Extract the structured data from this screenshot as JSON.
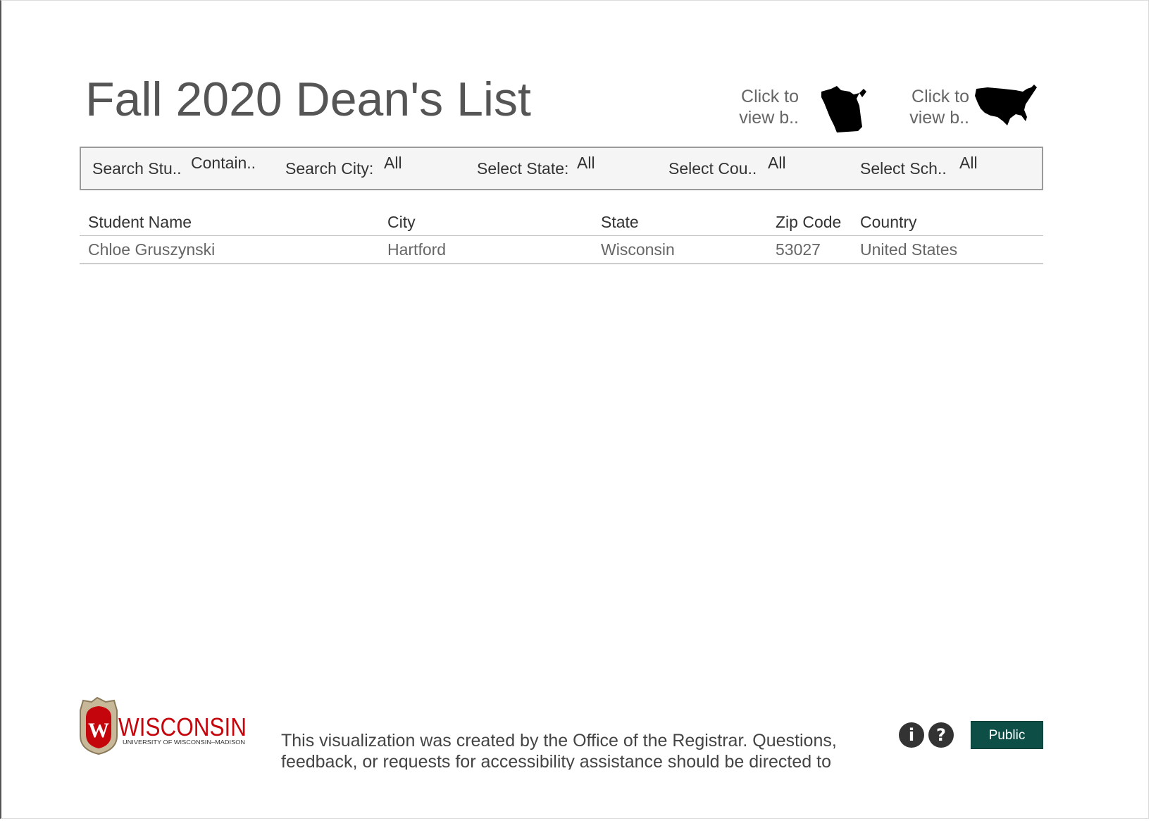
{
  "header": {
    "title": "Fall 2020 Dean's List",
    "nav_wisconsin": {
      "text": "Click to\nview b..",
      "icon": "wisconsin-map-icon"
    },
    "nav_usa": {
      "text": "Click to\nview b..",
      "icon": "usa-map-icon"
    }
  },
  "filters": [
    {
      "label": "Search Stu..",
      "value": "Contain.."
    },
    {
      "label": "Search City:",
      "value": "All"
    },
    {
      "label": "Select State:",
      "value": "All"
    },
    {
      "label": "Select Cou..",
      "value": "All"
    },
    {
      "label": "Select Sch..",
      "value": "All"
    }
  ],
  "table": {
    "columns": [
      "Student Name",
      "City",
      "State",
      "Zip Code",
      "Country"
    ],
    "rows": [
      [
        "Chloe Gruszynski",
        "Hartford",
        "Wisconsin",
        "53027",
        "United States"
      ]
    ]
  },
  "footer": {
    "logo_text": "WISCONSIN",
    "logo_subtext": "UNIVERSITY OF WISCONSIN–MADISON",
    "note": "This visualization was created by the Office of the Registrar.  Questions, feedback, or requests for accessibility assistance should be directed to",
    "info_icon": "info-icon",
    "help_icon": "help-icon",
    "public_label": "Public"
  },
  "colors": {
    "accent_public": "#0d4f47",
    "uw_red": "#c5050c",
    "text_gray": "#555555"
  }
}
